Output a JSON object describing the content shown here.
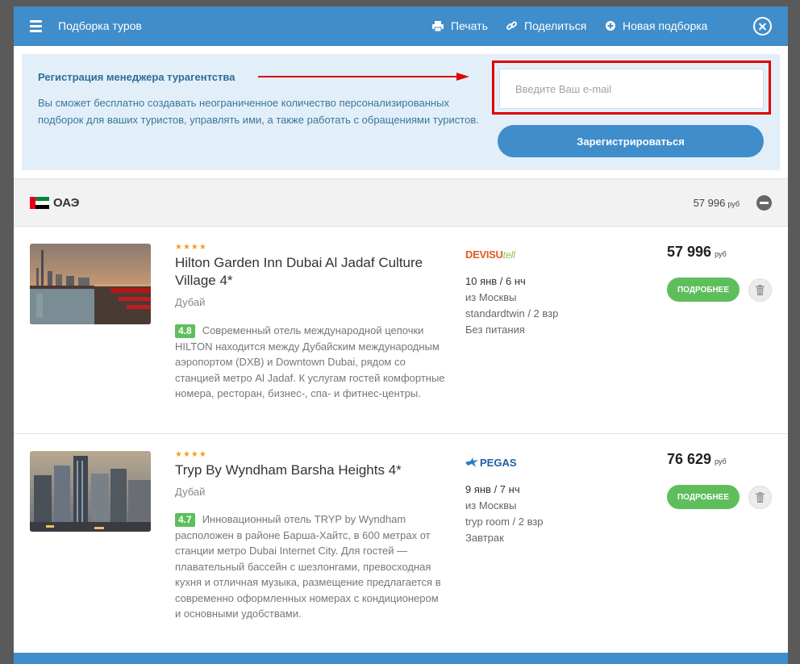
{
  "header": {
    "title": "Подборка туров",
    "actions": {
      "print": "Печать",
      "share": "Поделиться",
      "new": "Новая подборка"
    }
  },
  "registration": {
    "title": "Регистрация менеджера турагентства",
    "text": "Вы сможет бесплатно создавать неограниченное количество персонализированных подборок для ваших туристов, управлять ими, а также работать с обращениями туристов.",
    "email_placeholder": "Введите Ваш e-mail",
    "email_value": "",
    "button_label": "Зарегистрироваться"
  },
  "country": {
    "name": "ОАЭ",
    "price": "57 996",
    "currency": "руб"
  },
  "tours": [
    {
      "stars": "★★★★",
      "name": "Hilton Garden Inn Dubai Al Jadaf Culture Village 4*",
      "city": "Дубай",
      "rating": "4.8",
      "description": "Современный отель международной цепочки HILTON находится между Дубайским международным аэропортом (DXB) и Downtown Dubai, рядом со станцией метро Al Jadaf. К услугам гостей комфортные номера, ресторан, бизнес-, спа- и фитнес-центры.",
      "operator": "DEVISU",
      "operator_suffix": "tell",
      "dates": "10 янв / 6 нч",
      "departure": "из Москвы",
      "room": "standardtwin / 2 взр",
      "meal": "Без питания",
      "price": "57 996",
      "currency": "руб",
      "more_label": "ПОДРОБНЕЕ"
    },
    {
      "stars": "★★★★",
      "name": "Tryp By Wyndham Barsha Heights 4*",
      "city": "Дубай",
      "rating": "4.7",
      "description": "Инновационный отель TRYP by Wyndham расположен в районе Барша-Хайтс, в 600 метрах от станции метро Dubai Internet City. Для гостей — плавательный бассейн с шезлонгами, превосходная кухня и отличная музыка, размещение предлагается в современно оформленных номерах с кондиционером и основными удобствами.",
      "operator": "PEGAS",
      "dates": "9 янв / 7 нч",
      "departure": "из Москвы",
      "room": "tryp room / 2 взр",
      "meal": "Завтрак",
      "price": "76 629",
      "currency": "руб",
      "more_label": "ПОДРОБНЕЕ"
    }
  ],
  "colors": {
    "header_bg": "#3f8dcb",
    "reg_bg": "#e2eff9",
    "highlight_border": "#e00000",
    "rating_green": "#5ebe5c",
    "star_orange": "#f3a116"
  }
}
